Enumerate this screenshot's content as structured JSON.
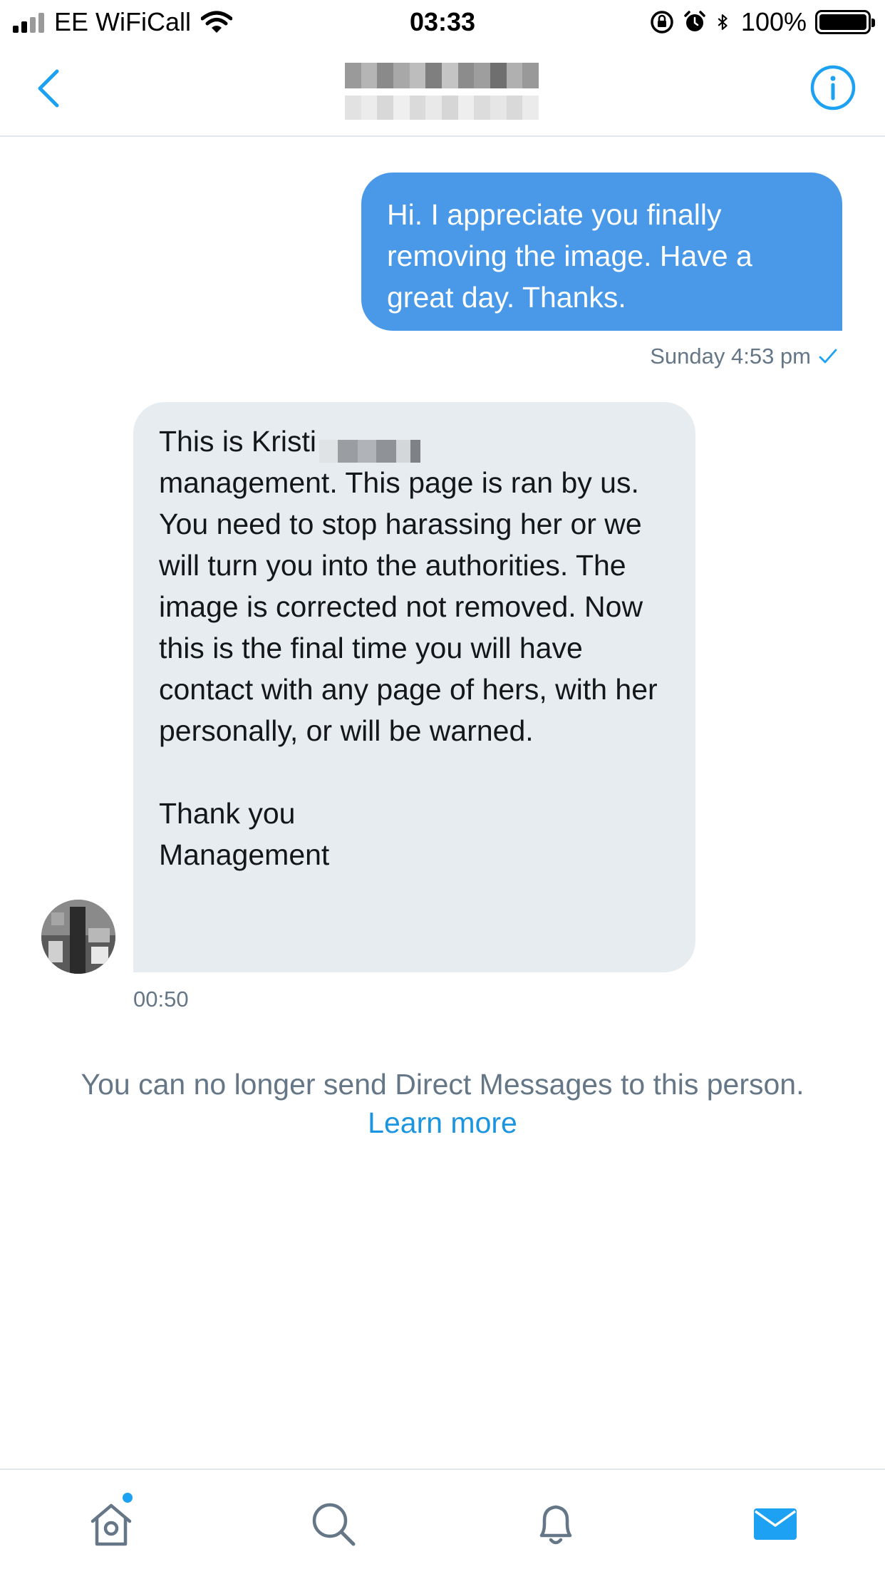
{
  "status_bar": {
    "carrier": "EE WiFiCall",
    "time": "03:33",
    "battery_percent": "100%",
    "icons": [
      "signal-icon",
      "wifi-icon",
      "rotation-lock-icon",
      "alarm-icon",
      "bluetooth-icon",
      "battery-icon"
    ]
  },
  "header": {
    "back_icon": "chevron-left-icon",
    "title_redacted": true,
    "info_icon": "info-icon"
  },
  "messages": [
    {
      "direction": "outgoing",
      "text": "Hi. I appreciate you finally removing the image. Have a great day. Thanks.",
      "timestamp": "Sunday 4:53 pm",
      "status_icon": "check-icon"
    },
    {
      "direction": "incoming",
      "text_first_line": "This is Kristi",
      "text_body": "management. This page is ran by us. You need to stop harassing her or we will turn you into the authorities. The image is corrected not removed. Now this is the final time you will have contact with any page of hers, with her personally, or will be warned.\n\nThank you\nManagement",
      "timestamp": "00:50"
    }
  ],
  "notice": {
    "text": "You can no longer send Direct Messages to this person.",
    "link": "Learn more"
  },
  "tabbar": {
    "tabs": [
      "home-icon",
      "search-icon",
      "notifications-icon",
      "messages-icon"
    ],
    "active": "messages-icon"
  },
  "colors": {
    "accent": "#1da1f2",
    "outgoing_bubble": "#4a99e9",
    "incoming_bubble": "#e6ecf0",
    "muted_text": "#657786",
    "link": "#1b95e0"
  }
}
